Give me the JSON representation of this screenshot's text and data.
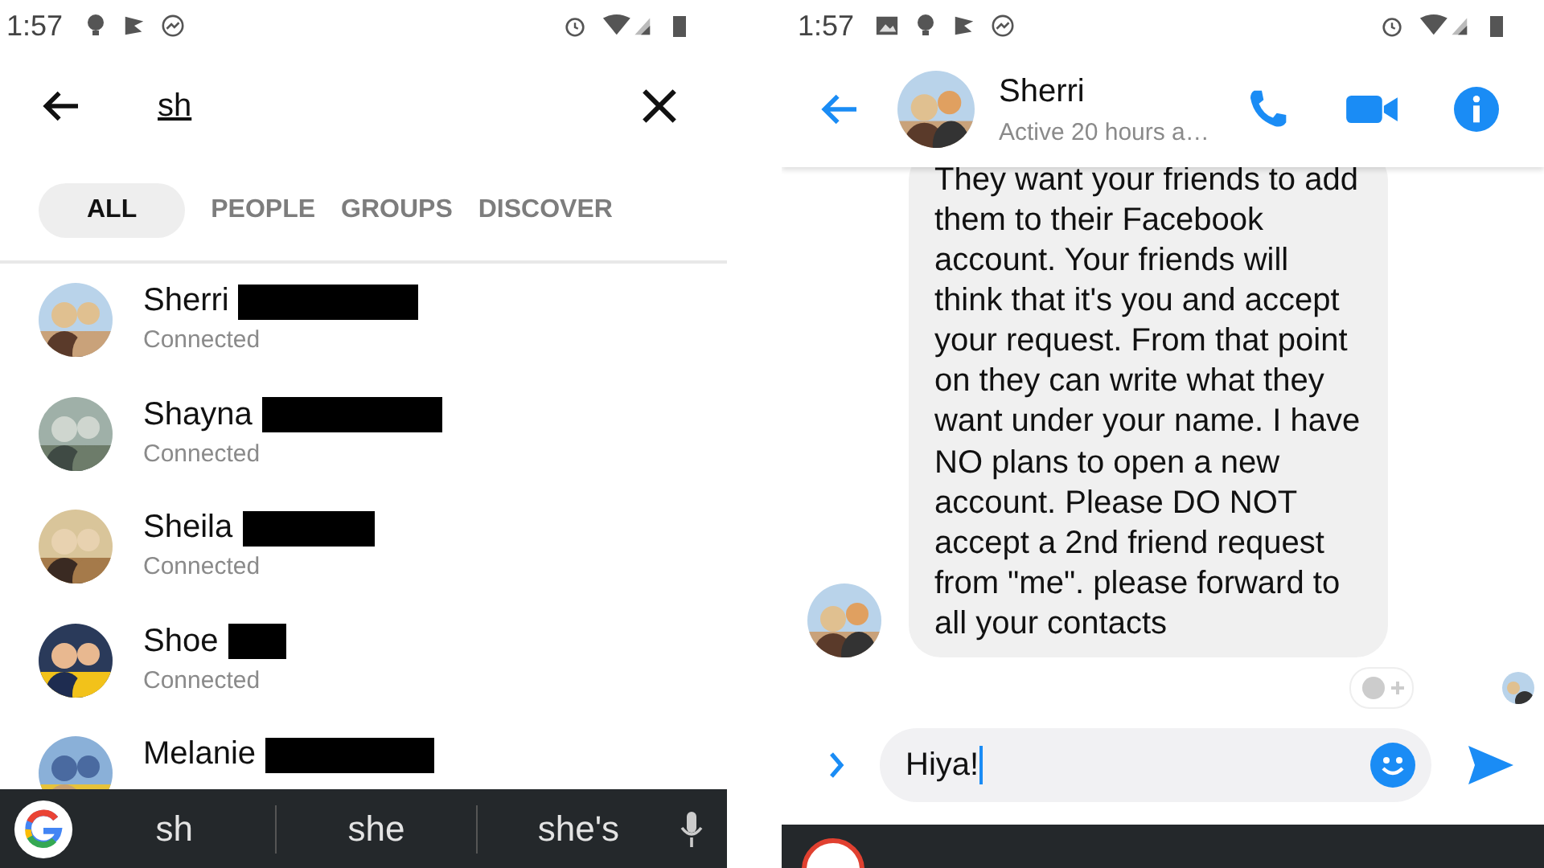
{
  "left": {
    "status_bar": {
      "time": "1:57"
    },
    "search": {
      "value": "sh"
    },
    "tabs": [
      {
        "label": "ALL",
        "selected": true
      },
      {
        "label": "PEOPLE",
        "selected": false
      },
      {
        "label": "GROUPS",
        "selected": false
      },
      {
        "label": "DISCOVER",
        "selected": false
      }
    ],
    "results": [
      {
        "name": "Sherri",
        "status": "Connected"
      },
      {
        "name": "Shayna",
        "status": "Connected"
      },
      {
        "name": "Sheila",
        "status": "Connected"
      },
      {
        "name": "Shoe",
        "status": "Connected"
      },
      {
        "name": "Melanie"
      }
    ],
    "keyboard_suggestions": [
      "sh",
      "she",
      "she's"
    ]
  },
  "right": {
    "status_bar": {
      "time": "1:57"
    },
    "contact": {
      "name": "Sherri",
      "status": "Active 20 hours a…"
    },
    "message": {
      "text": "They want your friends to add them to their Facebook account. Your friends will think that it's you and accept your request. From that point on they can write what they want under your name. I have NO plans to open a new account. Please DO NOT accept a 2nd friend request from \"me\". please forward to all your contacts"
    },
    "composer": {
      "value": "Hiya!"
    }
  }
}
